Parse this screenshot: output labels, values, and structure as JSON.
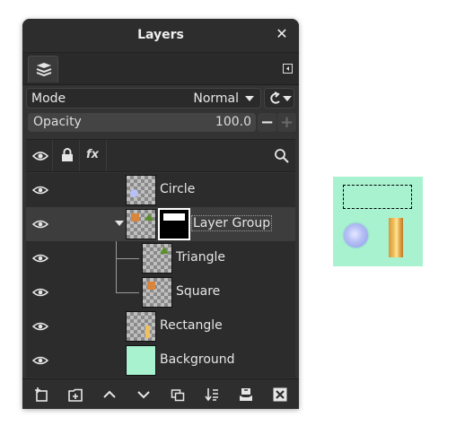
{
  "dialog": {
    "title": "Layers",
    "close_icon": "close-icon",
    "tab_icon": "layers-stack-icon",
    "tab_menu_icon": "tab-menu-icon"
  },
  "mode": {
    "label": "Mode",
    "value": "Normal",
    "composite_icon": "composite-mode-icon"
  },
  "opacity": {
    "label": "Opacity",
    "value": "100.0",
    "decrease_icon": "minus-icon",
    "increase_icon": "plus-icon"
  },
  "header": {
    "visibility_icon": "eye-icon",
    "lock_icon": "lock-icon",
    "effects_label": "fx",
    "search_icon": "search-icon"
  },
  "layers": [
    {
      "name": "Circle",
      "visible": true,
      "depth": 0
    },
    {
      "name": "Layer Group",
      "visible": true,
      "depth": 0,
      "expanded": true,
      "selected": true,
      "has_mask": true
    },
    {
      "name": "Triangle",
      "visible": true,
      "depth": 1
    },
    {
      "name": "Square",
      "visible": true,
      "depth": 1
    },
    {
      "name": "Rectangle",
      "visible": true,
      "depth": 0
    },
    {
      "name": "Background",
      "visible": true,
      "depth": 0
    }
  ],
  "toolbar": [
    {
      "icon": "new-layer-icon"
    },
    {
      "icon": "new-group-icon"
    },
    {
      "icon": "raise-layer-icon"
    },
    {
      "icon": "lower-layer-icon"
    },
    {
      "icon": "duplicate-layer-icon"
    },
    {
      "icon": "merge-down-icon"
    },
    {
      "icon": "anchor-layer-icon"
    },
    {
      "icon": "delete-layer-icon"
    }
  ],
  "colors": {
    "panel_bg": "#333333",
    "selected_row": "#3d3d3d",
    "canvas_bg": "#a8f2d0",
    "circle_fill": "#b7c1f5",
    "rectangle_fill": "#f0c05a"
  }
}
